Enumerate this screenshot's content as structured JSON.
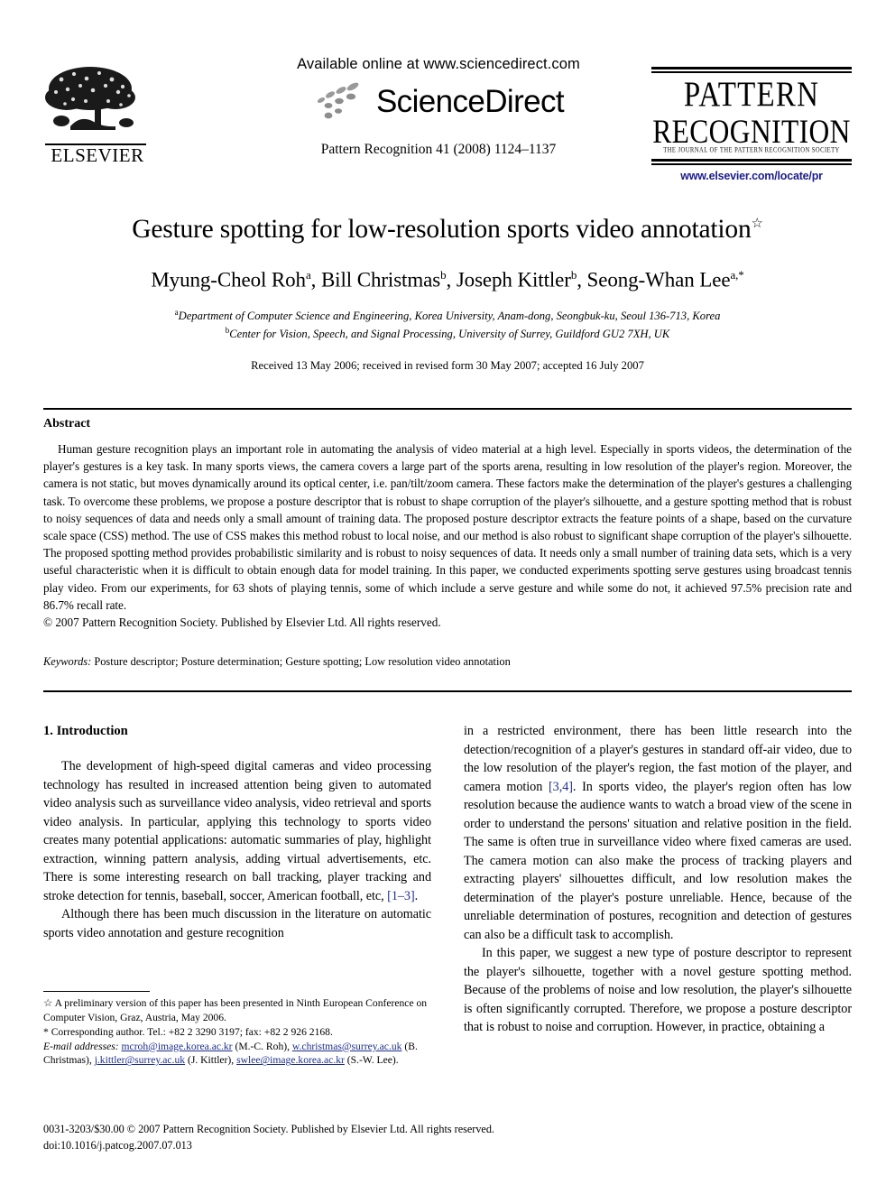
{
  "masthead": {
    "elsevier": {
      "wordmark": "ELSEVIER",
      "logo_icon": "elsevier-tree-icon"
    },
    "sciencedirect": {
      "available_line": "Available online at www.sciencedirect.com",
      "wordmark": "ScienceDirect",
      "logo_icon": "sciencedirect-dots-icon",
      "journal_ref": "Pattern Recognition 41 (2008) 1124–1137"
    },
    "journal_logo": {
      "line1": "PATTERN",
      "line2": "RECOGNITION",
      "subtitle": "THE JOURNAL OF THE PATTERN RECOGNITION SOCIETY",
      "url": "www.elsevier.com/locate/pr",
      "url_color": "#1c1c8c"
    }
  },
  "title_area": {
    "title": "Gesture spotting for low-resolution sports video annotation",
    "title_footnote_marker": "☆",
    "authors": [
      {
        "name": "Myung-Cheol Roh",
        "sup": "a"
      },
      {
        "name": "Bill Christmas",
        "sup": "b"
      },
      {
        "name": "Joseph Kittler",
        "sup": "b"
      },
      {
        "name": "Seong-Whan Lee",
        "sup": "a,*"
      }
    ],
    "authors_line": "Myung-Cheol Roh",
    "affiliations": [
      {
        "sup": "a",
        "text": "Department of Computer Science and Engineering, Korea University, Anam-dong, Seongbuk-ku, Seoul 136-713, Korea"
      },
      {
        "sup": "b",
        "text": "Center for Vision, Speech, and Signal Processing, University of Surrey, Guildford GU2 7XH, UK"
      }
    ],
    "history": "Received 13 May 2006; received in revised form 30 May 2007; accepted 16 July 2007"
  },
  "abstract": {
    "heading": "Abstract",
    "body": "Human gesture recognition plays an important role in automating the analysis of video material at a high level. Especially in sports videos, the determination of the player's gestures is a key task. In many sports views, the camera covers a large part of the sports arena, resulting in low resolution of the player's region. Moreover, the camera is not static, but moves dynamically around its optical center, i.e. pan/tilt/zoom camera. These factors make the determination of the player's gestures a challenging task. To overcome these problems, we propose a posture descriptor that is robust to shape corruption of the player's silhouette, and a gesture spotting method that is robust to noisy sequences of data and needs only a small amount of training data. The proposed posture descriptor extracts the feature points of a shape, based on the curvature scale space (CSS) method. The use of CSS makes this method robust to local noise, and our method is also robust to significant shape corruption of the player's silhouette. The proposed spotting method provides probabilistic similarity and is robust to noisy sequences of data. It needs only a small number of training data sets, which is a very useful characteristic when it is difficult to obtain enough data for model training. In this paper, we conducted experiments spotting serve gestures using broadcast tennis play video. From our experiments, for 63 shots of playing tennis, some of which include a serve gesture and while some do not, it achieved 97.5% precision rate and 86.7% recall rate.",
    "copyright": "© 2007 Pattern Recognition Society. Published by Elsevier Ltd. All rights reserved."
  },
  "keywords": {
    "label": "Keywords:",
    "value": "Posture descriptor; Posture determination; Gesture spotting; Low resolution video annotation"
  },
  "body": {
    "section_heading": "1. Introduction",
    "left_paragraphs": [
      "The development of high-speed digital cameras and video processing technology has resulted in increased attention being given to automated video analysis such as surveillance video analysis, video retrieval and sports video analysis. In particular, applying this technology to sports video creates many potential applications: automatic summaries of play, highlight extraction, winning pattern analysis, adding virtual advertisements, etc. There is some interesting research on ball tracking, player tracking and stroke detection for tennis, baseball, soccer, American football, etc,",
      "Although there has been much discussion in the literature on automatic sports video annotation and gesture recognition"
    ],
    "left_ref_1": "[1–3]",
    "left_ref_1_tail": ".",
    "right_paragraphs": [
      "in a restricted environment, there has been little research into the detection/recognition of a player's gestures in standard off-air video, due to the low resolution of the player's region, the fast motion of the player, and camera motion",
      "In this paper, we suggest a new type of posture descriptor to represent the player's silhouette, together with a novel gesture spotting method. Because of the problems of noise and low resolution, the player's silhouette is often significantly corrupted. Therefore, we propose a posture descriptor that is robust to noise and corruption. However, in practice, obtaining a"
    ],
    "right_ref_1": "[3,4]",
    "right_para_1_tail": ". In sports video, the player's region often has low resolution because the audience wants to watch a broad view of the scene in order to understand the persons' situation and relative position in the field. The same is often true in surveillance video where fixed cameras are used. The camera motion can also make the process of tracking players and extracting players' silhouettes difficult, and low resolution makes the determination of the player's posture unreliable. Hence, because of the unreliable determination of postures, recognition and detection of gestures can also be a difficult task to accomplish."
  },
  "footnote": {
    "star_marker": "☆",
    "star_text": "A preliminary version of this paper has been presented in Ninth European Conference on Computer Vision, Graz, Austria, May 2006.",
    "asterisk_marker": "*",
    "asterisk_text": "Corresponding author. Tel.: +82 2 3290 3197; fax: +82 2 926 2168.",
    "email_label": "E-mail addresses:",
    "emails": [
      {
        "address": "mcroh@image.korea.ac.kr",
        "owner": "(M.-C. Roh),"
      },
      {
        "address": "w.christmas@surrey.ac.uk",
        "owner": "(B. Christmas),"
      },
      {
        "address": "j.kittler@surrey.ac.uk",
        "owner": "(J. Kittler),"
      },
      {
        "address": "swlee@image.korea.ac.kr",
        "owner": "(S.-W. Lee)."
      }
    ],
    "link_color": "#1d2f8a"
  },
  "page_footer": {
    "issn_line": "0031-3203/$30.00 © 2007 Pattern Recognition Society. Published by Elsevier Ltd. All rights reserved.",
    "doi_line": "doi:10.1016/j.patcog.2007.07.013"
  }
}
